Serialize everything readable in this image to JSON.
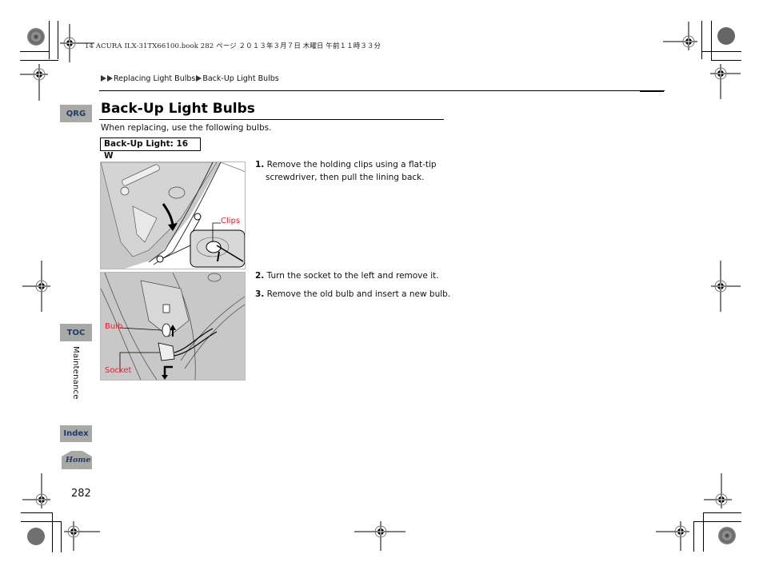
{
  "print_header": {
    "text": "14 ACURA ILX-31TX66100.book  282 ページ  ２０１３年３月７日  木曜日  午前１１時３３分"
  },
  "breadcrumb": {
    "items": [
      "Replacing Light Bulbs",
      "Back-Up Light Bulbs"
    ],
    "marker_icon": "double-triangle-right-icon"
  },
  "side_nav": {
    "qrg": "QRG",
    "toc": "TOC",
    "section": "Maintenance",
    "index": "Index",
    "home": "Home"
  },
  "section": {
    "title": "Back-Up Light Bulbs",
    "intro": "When replacing, use the following bulbs.",
    "spec": "Back-Up Light: 16 W"
  },
  "figures": {
    "fig1": {
      "labels": [
        "Clips"
      ]
    },
    "fig2": {
      "labels": [
        "Bulb",
        "Socket"
      ]
    }
  },
  "steps": [
    {
      "num": "1.",
      "line1": "Remove the holding clips using a flat-tip",
      "line2": "screwdriver, then pull the lining back."
    },
    {
      "num": "2.",
      "line1": "Turn the socket to the left and remove it."
    },
    {
      "num": "3.",
      "line1": "Remove the old bulb and insert a new bulb."
    }
  ],
  "page_number": "282",
  "colors": {
    "nav_button_bg": "#a8a8a4",
    "nav_button_text": "#1f3b6b",
    "callout_red": "#e8202a",
    "figure_gray": "#c8c8c8"
  }
}
